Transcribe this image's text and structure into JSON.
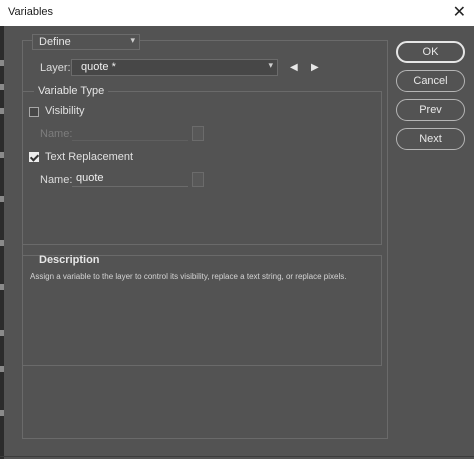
{
  "window": {
    "title": "Variables",
    "close_label": "✕"
  },
  "define_select": {
    "value": "Define"
  },
  "layer": {
    "label": "Layer:",
    "value": "quote *"
  },
  "variable_type": {
    "label": "Variable Type",
    "visibility": {
      "label": "Visibility",
      "checked": false,
      "name_label": "Name:",
      "name_value": ""
    },
    "text_replacement": {
      "label": "Text Replacement",
      "checked": true,
      "name_label": "Name:",
      "name_value": "quote"
    }
  },
  "description": {
    "title": "Description",
    "text": "Assign a variable to the layer to control its visibility, replace a text string, or replace pixels."
  },
  "buttons": {
    "ok": "OK",
    "cancel": "Cancel",
    "prev": "Prev",
    "next": "Next"
  },
  "icons": {
    "chevron": "▾",
    "prev_layer": "◀",
    "next_layer": "▶"
  },
  "colors": {
    "background": "#535353",
    "title_bar": "#ffffff",
    "border": "#6a6a6a"
  }
}
